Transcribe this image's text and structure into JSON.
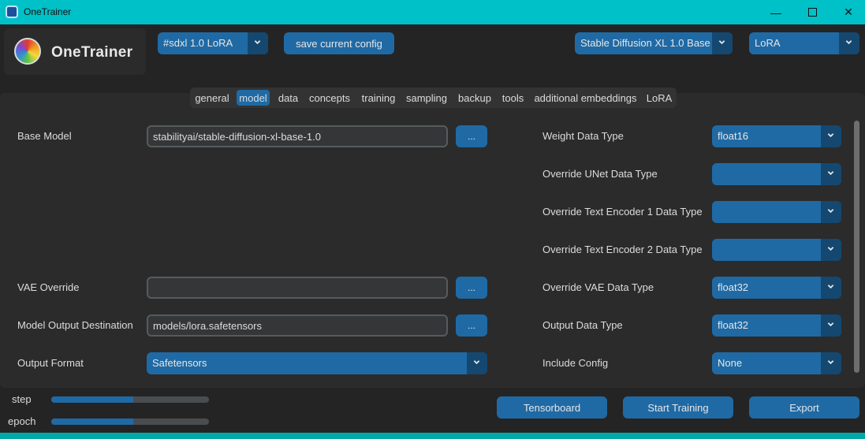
{
  "window": {
    "title": "OneTrainer",
    "controls": {
      "minimize": "—",
      "close": "✕"
    }
  },
  "header": {
    "logo_text": "OneTrainer",
    "config_select": "#sdxl 1.0 LoRA",
    "save_config_label": "save current config",
    "model_type_select": "Stable Diffusion XL 1.0 Base",
    "training_method_select": "LoRA"
  },
  "tabs": [
    {
      "label": "general"
    },
    {
      "label": "model",
      "active": true
    },
    {
      "label": "data"
    },
    {
      "label": "concepts"
    },
    {
      "label": "training"
    },
    {
      "label": "sampling"
    },
    {
      "label": "backup"
    },
    {
      "label": "tools"
    },
    {
      "label": "additional embeddings"
    },
    {
      "label": "LoRA"
    }
  ],
  "model_tab": {
    "browse_label": "...",
    "base_model": {
      "label": "Base Model",
      "value": "stabilityai/stable-diffusion-xl-base-1.0"
    },
    "vae_override": {
      "label": "VAE Override",
      "value": ""
    },
    "output_destination": {
      "label": "Model Output Destination",
      "value": "models/lora.safetensors"
    },
    "output_format": {
      "label": "Output Format",
      "value": "Safetensors"
    },
    "weight_dtype": {
      "label": "Weight Data Type",
      "value": "float16"
    },
    "unet_dtype": {
      "label": "Override UNet Data Type",
      "value": ""
    },
    "te1_dtype": {
      "label": "Override Text Encoder 1 Data Type",
      "value": ""
    },
    "te2_dtype": {
      "label": "Override Text Encoder 2 Data Type",
      "value": ""
    },
    "vae_dtype": {
      "label": "Override VAE Data Type",
      "value": "float32"
    },
    "output_dtype": {
      "label": "Output Data Type",
      "value": "float32"
    },
    "include_config": {
      "label": "Include Config",
      "value": "None"
    }
  },
  "footer": {
    "step_label": "step",
    "step_progress": 0.52,
    "epoch_label": "epoch",
    "epoch_progress": 0.52,
    "tensorboard_label": "Tensorboard",
    "start_training_label": "Start Training",
    "export_label": "Export"
  },
  "colors": {
    "accent": "#1f6aa5",
    "accent_dark": "#144870",
    "titlebar": "#00c0c8",
    "panel": "#2b2b2b",
    "background": "#242424"
  }
}
